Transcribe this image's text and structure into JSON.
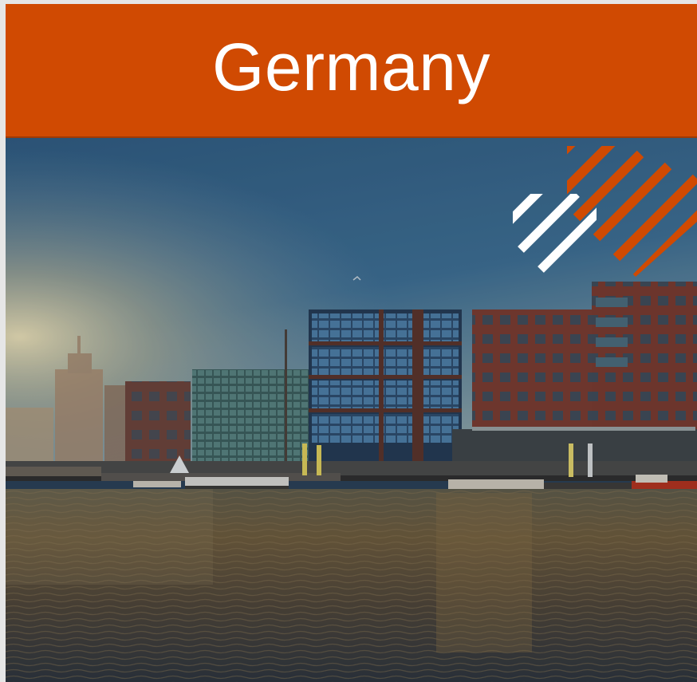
{
  "banner": {
    "title": "Germany",
    "background_color": "#d04a02"
  },
  "photo": {
    "description_icon": "harbor-cityscape-photo"
  },
  "decor": {
    "stripe_colors": [
      "#d04a02",
      "#ffffff"
    ]
  }
}
